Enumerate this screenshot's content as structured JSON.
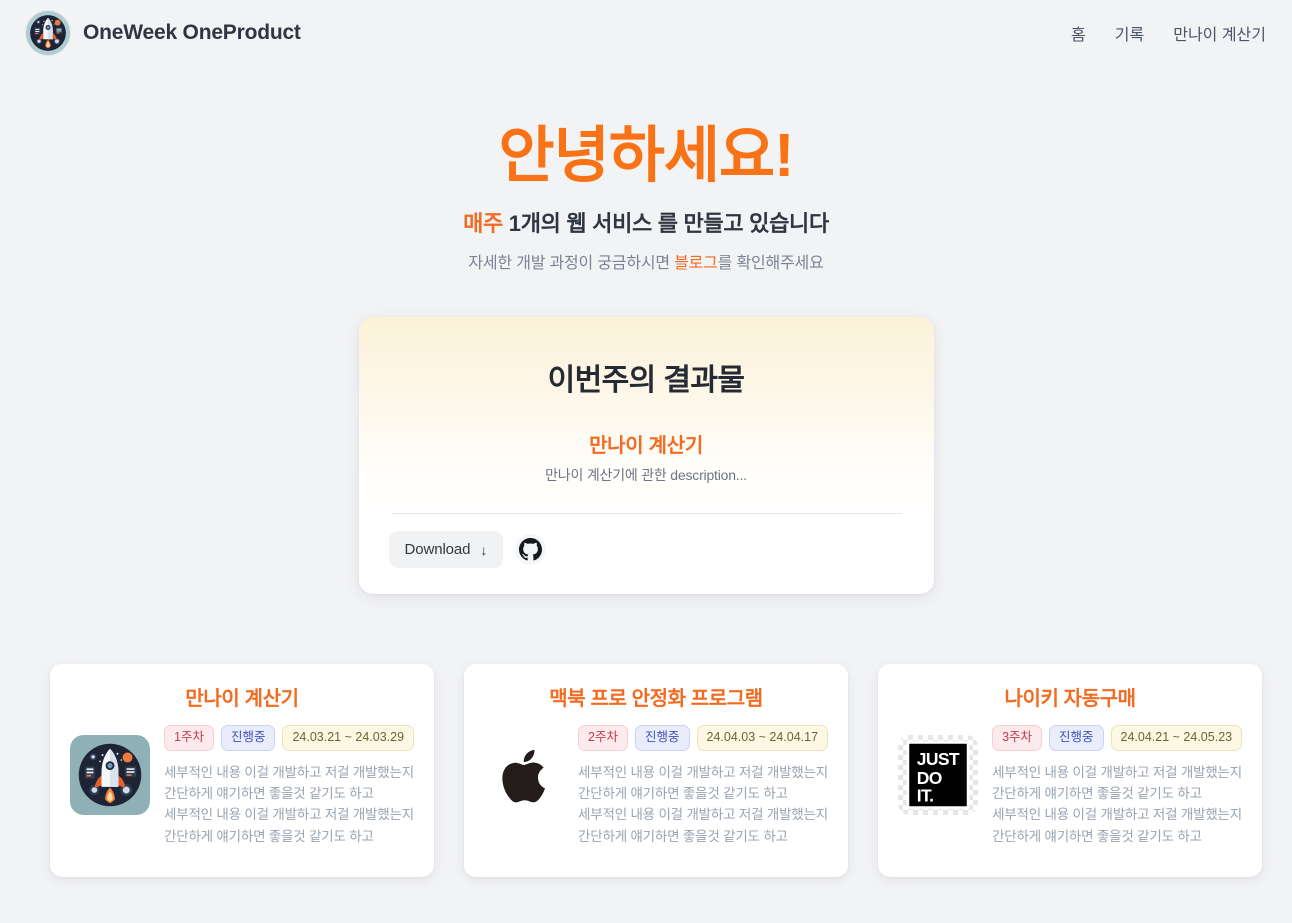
{
  "header": {
    "brand_title": "OneWeek OneProduct",
    "logo_icon": "rocket-logo-icon",
    "nav": [
      {
        "label": "홈",
        "name": "nav-home"
      },
      {
        "label": "기록",
        "name": "nav-records"
      },
      {
        "label": "만나이 계산기",
        "name": "nav-age-calculator"
      }
    ]
  },
  "hero": {
    "title": "안녕하세요!",
    "subtitle_accent": "매주",
    "subtitle_rest": "1개의 웹 서비스 를 만들고 있습니다",
    "note_before": "자세한 개발 과정이 궁금하시면 ",
    "note_link": "블로그",
    "note_after": "를 확인해주세요"
  },
  "featured": {
    "heading": "이번주의 결과물",
    "product_name": "만나이 계산기",
    "description": "만나이 계산기에 관한 description...",
    "download_label": "Download",
    "download_arrow": "↓",
    "github_icon": "github-icon"
  },
  "projects": [
    {
      "title": "만나이 계산기",
      "thumb_icon": "rocket-thumbnail-icon",
      "week": "1주차",
      "status": "진행중",
      "date_range": "24.03.21 ~ 24.03.29",
      "description": "세부적인 내용 이걸 개발하고 저걸 개발했는지 간단하게 얘기하면 좋을것 같기도 하고 세부적인 내용 이걸 개발하고 저걸 개발했는지 간단하게 얘기하면 좋을것 같기도 하고"
    },
    {
      "title": "맥북 프로 안정화 프로그램",
      "thumb_icon": "apple-logo-icon",
      "week": "2주차",
      "status": "진행중",
      "date_range": "24.04.03 ~ 24.04.17",
      "description": "세부적인 내용 이걸 개발하고 저걸 개발했는지 간단하게 얘기하면 좋을것 같기도 하고 세부적인 내용 이걸 개발하고 저걸 개발했는지 간단하게 얘기하면 좋을것 같기도 하고"
    },
    {
      "title": "나이키 자동구매",
      "thumb_icon": "just-do-it-logo-icon",
      "week": "3주차",
      "status": "진행중",
      "date_range": "24.04.21 ~ 24.05.23",
      "description": "세부적인 내용 이걸 개발하고 저걸 개발했는지 간단하게 얘기하면 좋을것 같기도 하고 세부적인 내용 이걸 개발하고 저걸 개발했는지 간단하게 얘기하면 좋을것 같기도 하고"
    }
  ],
  "colors": {
    "accent_orange": "#f26b21",
    "hero_orange": "#f97316",
    "page_bg": "#f2f3f5",
    "text_dark": "#2f3640",
    "text_muted": "#9aa3b0",
    "badge_week_bg": "#fdeaec",
    "badge_status_bg": "#e9ecfb",
    "badge_date_bg": "#fdf8e3",
    "featured_gradient_top": "#fcf2d8"
  }
}
